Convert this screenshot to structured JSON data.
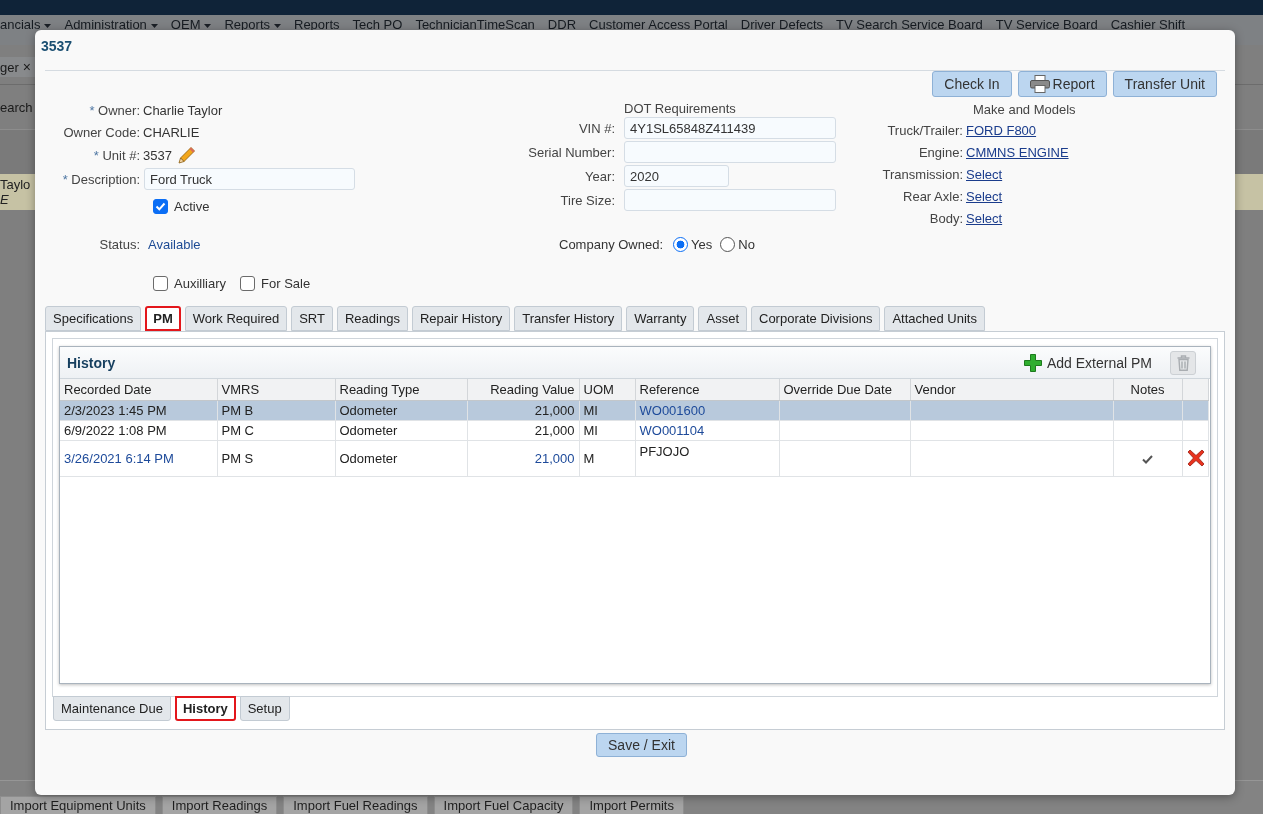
{
  "background": {
    "menu": [
      {
        "label": "ancials",
        "dropdown": true
      },
      {
        "label": "Administration",
        "dropdown": true
      },
      {
        "label": "OEM",
        "dropdown": true
      },
      {
        "label": "Reports",
        "dropdown": true
      },
      {
        "label": "Reports",
        "dropdown": false
      },
      {
        "label": "Tech PO",
        "dropdown": false
      },
      {
        "label": "TechnicianTimeScan",
        "dropdown": false
      },
      {
        "label": "DDR",
        "dropdown": false
      },
      {
        "label": "Customer Access Portal",
        "dropdown": false
      },
      {
        "label": "Driver Defects",
        "dropdown": false
      },
      {
        "label": "TV Search Service Board",
        "dropdown": false
      },
      {
        "label": "TV Service Board",
        "dropdown": false
      },
      {
        "label": "Cashier Shift",
        "dropdown": false
      }
    ],
    "page_tab": {
      "label": "ger",
      "close": "×"
    },
    "search_label": "earch",
    "list_row": {
      "line_1": "Taylo",
      "line_2": "E"
    },
    "import_buttons": [
      "Import Equipment Units",
      "Import Readings",
      "Import Fuel Readings",
      "Import Fuel Capacity",
      "Import Permits"
    ]
  },
  "dialog": {
    "title": "3537",
    "actions": [
      {
        "label": "Check In",
        "kind": "check_in"
      },
      {
        "label": "Report",
        "kind": "report"
      },
      {
        "label": "Transfer Unit",
        "kind": "transfer"
      }
    ],
    "general": [
      {
        "kind": "text",
        "mark": "*",
        "label": "Owner:",
        "value": "Charlie Taylor"
      },
      {
        "kind": "text",
        "label": "Owner Code:",
        "value": "CHARLIE"
      },
      {
        "kind": "editable",
        "mark": "*",
        "label": "Unit #:",
        "value": "3537"
      },
      {
        "kind": "input",
        "mark": "*",
        "label": "Description:",
        "value": "Ford Truck"
      },
      {
        "kind": "checkbox",
        "label": "Active",
        "checked": true
      },
      {
        "kind": "status",
        "label": "Status:",
        "value": "Available"
      },
      {
        "kind": "checkbox_pair",
        "options": [
          {
            "label": "Auxilliary",
            "checked": false
          },
          {
            "label": "For Sale",
            "checked": false
          }
        ]
      }
    ],
    "dot_requirements": {
      "title": "DOT Requirements",
      "fields": [
        {
          "kind": "text",
          "label": "VIN #:",
          "value": "4Y1SL65848Z411439"
        },
        {
          "kind": "text",
          "label": "Serial Number:"
        },
        {
          "kind": "number",
          "label": "Year:",
          "value": "2020"
        },
        {
          "kind": "text",
          "label": "Tire Size:"
        }
      ],
      "company_owned": {
        "label": "Company Owned:",
        "options": [
          {
            "label": "Yes",
            "selected": true
          },
          {
            "label": "No",
            "selected": false
          }
        ]
      }
    },
    "make_and_models": {
      "title": "Make and Models",
      "items": [
        {
          "label": "Truck/Trailer:",
          "value": "FORD F800"
        },
        {
          "label": "Engine:",
          "value": "CMMNS ENGINE"
        },
        {
          "label": "Transmission:",
          "value": "Select"
        },
        {
          "label": "Rear Axle:",
          "value": "Select"
        },
        {
          "label": "Body:",
          "value": "Select"
        }
      ]
    },
    "tabs": [
      {
        "label": "Specifications",
        "selected": false,
        "highlighted": false
      },
      {
        "label": "PM",
        "selected": true,
        "highlighted": true
      },
      {
        "label": "Work Required",
        "selected": false,
        "highlighted": false
      },
      {
        "label": "SRT",
        "selected": false,
        "highlighted": false
      },
      {
        "label": "Readings",
        "selected": false,
        "highlighted": false
      },
      {
        "label": "Repair History",
        "selected": false,
        "highlighted": false
      },
      {
        "label": "Transfer History",
        "selected": false,
        "highlighted": false
      },
      {
        "label": "Warranty",
        "selected": false,
        "highlighted": false
      },
      {
        "label": "Asset",
        "selected": false,
        "highlighted": false
      },
      {
        "label": "Corporate Divisions",
        "selected": false,
        "highlighted": false
      },
      {
        "label": "Attached Units",
        "selected": false,
        "highlighted": false
      }
    ],
    "pm": {
      "history": {
        "title": "History",
        "add_label": "Add External PM",
        "delete_disabled": true,
        "columns": [
          "Recorded Date",
          "VMRS",
          "Reading Type",
          "Reading Value",
          "UOM",
          "Reference",
          "Override Due Date",
          "Vendor",
          "Notes"
        ],
        "rows": [
          {
            "kind": "work_order",
            "selected": true,
            "recorded_date": "2/3/2023 1:45 PM",
            "vmrs": "PM B",
            "reading_type": "Odometer",
            "reading_value": "21,000",
            "uom": "MI",
            "reference": "WO001600",
            "has_notes": false
          },
          {
            "kind": "work_order",
            "selected": false,
            "recorded_date": "6/9/2022 1:08 PM",
            "vmrs": "PM C",
            "reading_type": "Odometer",
            "reading_value": "21,000",
            "uom": "MI",
            "reference": "WO001104",
            "has_notes": false
          },
          {
            "kind": "external",
            "selected": false,
            "recorded_date": "3/26/2021 6:14 PM",
            "vmrs": "PM S",
            "reading_type": "Odometer",
            "reading_value": "21,000",
            "uom": "M",
            "reference": "PFJOJO",
            "has_notes": true
          }
        ]
      },
      "subtabs": [
        {
          "label": "Maintenance Due",
          "selected": false,
          "highlighted": false
        },
        {
          "label": "History",
          "selected": true,
          "highlighted": true
        },
        {
          "label": "Setup",
          "selected": false,
          "highlighted": false
        }
      ]
    },
    "save_button": "Save / Exit"
  }
}
